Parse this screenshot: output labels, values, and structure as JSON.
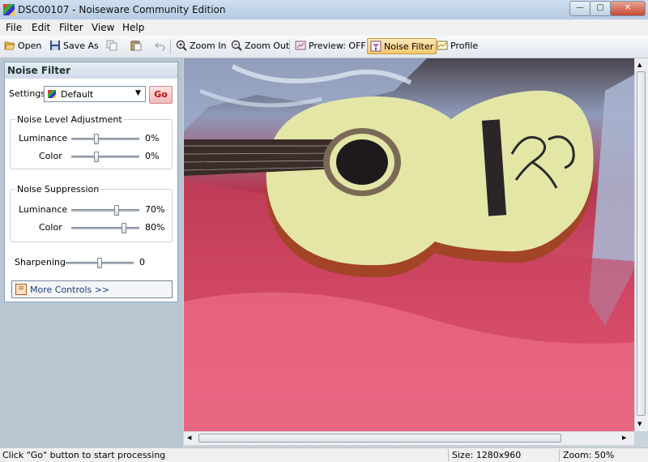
{
  "window": {
    "title": "DSC00107 - Noiseware Community Edition",
    "controls": {
      "minimize": "—",
      "maximize": "▢",
      "close": "✕"
    }
  },
  "menu": [
    "File",
    "Edit",
    "Filter",
    "View",
    "Help"
  ],
  "toolbar": {
    "open": "Open",
    "save_as": "Save As",
    "zoom_in": "Zoom In",
    "zoom_out": "Zoom Out",
    "preview": "Preview: OFF",
    "noise_filter": "Noise Filter",
    "profile": "Profile"
  },
  "panel": {
    "title": "Noise Filter",
    "settings_label": "Settings",
    "settings_value": "Default",
    "go_label": "Go",
    "noise_level": {
      "title": "Noise Level Adjustment",
      "luminance_label": "Luminance",
      "luminance_value": "0%",
      "luminance_level": 0.36,
      "color_label": "Color",
      "color_value": "0%",
      "color_level": 0.36
    },
    "noise_suppression": {
      "title": "Noise Suppression",
      "luminance_label": "Luminance",
      "luminance_value": "70%",
      "luminance_level": 0.68,
      "color_label": "Color",
      "color_value": "80%",
      "color_level": 0.79
    },
    "sharpening": {
      "label": "Sharpening",
      "value": "0",
      "level": 0.5
    },
    "more_controls": "More Controls >>"
  },
  "status": {
    "message": "Click \"Go\" button to start processing",
    "size": "Size: 1280x960",
    "zoom": "Zoom: 50%"
  },
  "image": {
    "signature": "Raul"
  },
  "colors": {
    "accent": "#f8c96e",
    "go": "#b11111",
    "guitar_top": "#e6e6a8",
    "guitar_side": "#a54a2a"
  }
}
